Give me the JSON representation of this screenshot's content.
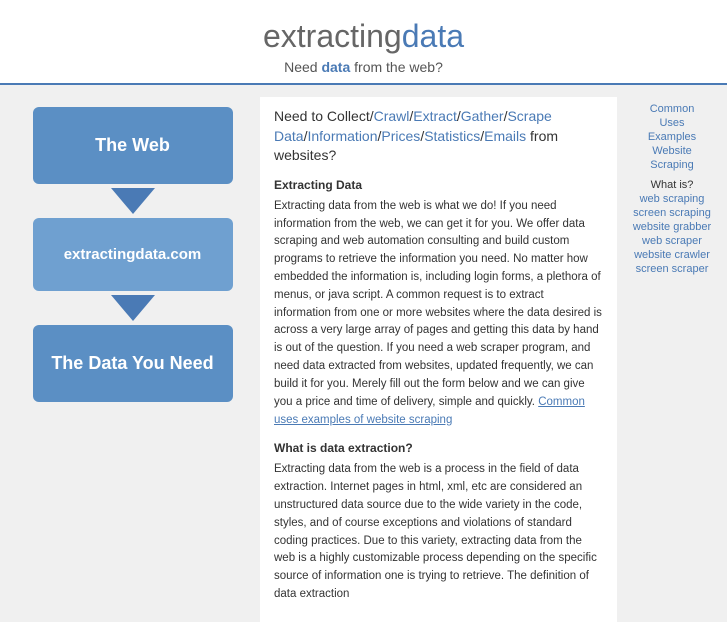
{
  "header": {
    "title_gray": "extracting",
    "title_blue": "data",
    "tagline_before": "Need ",
    "tagline_data": "data",
    "tagline_after": " from the web?"
  },
  "left_panel": {
    "box_top": "The Web",
    "box_mid": "extractingdata.com",
    "box_bot": "The Data You Need"
  },
  "center": {
    "headline_plain": "Need to Collect/",
    "headline_links": [
      "Crawl",
      "Extract",
      "Gather",
      "Scrape Data",
      "Information",
      "Prices",
      "Statistics",
      "Emails"
    ],
    "headline_end": " from websites?",
    "section1_title": "Extracting Data",
    "section1_body": "Extracting data from the web is what we do! If you need information from the web, we can get it for you.  We offer data scraping and web automation consulting and build custom programs to retrieve the information you need. No matter how embedded the information is, including login forms, a plethora of menus, or java script.  A common request is to extract information from one or more websites where the data desired is across a very large array of pages and getting this data by hand is out of the question.  If you need a web scraper program, and need data extracted from websites, updated frequently, we can build it for you.   Merely fill out the form below and we can give you a price and time of delivery, simple and quickly.",
    "inline_link_text": "Common uses examples of website scraping",
    "section2_title": "What is data extraction?",
    "section2_body": "Extracting data from the web is a process in the field of data extraction. Internet pages in html, xml, etc are considered an unstructured data source due to the wide variety in the code, styles, and of course exceptions and violations of standard coding practices.  Due to this variety, extracting data from the web is a highly customizable process depending on the specific source of information one is trying to retrieve.  The definition of data extraction"
  },
  "sidebar": {
    "top_links": [
      "Common",
      "Uses",
      "Examples",
      "Website",
      "Scraping"
    ],
    "what_is_label": "What is?",
    "what_is_links": [
      {
        "label": "web scraping",
        "href": "#"
      },
      {
        "label": "screen scraping",
        "href": "#"
      },
      {
        "label": "website grabber",
        "href": "#"
      },
      {
        "label": "web scraper",
        "href": "#"
      },
      {
        "label": "website crawler",
        "href": "#"
      },
      {
        "label": "screen scraper",
        "href": "#"
      }
    ]
  }
}
